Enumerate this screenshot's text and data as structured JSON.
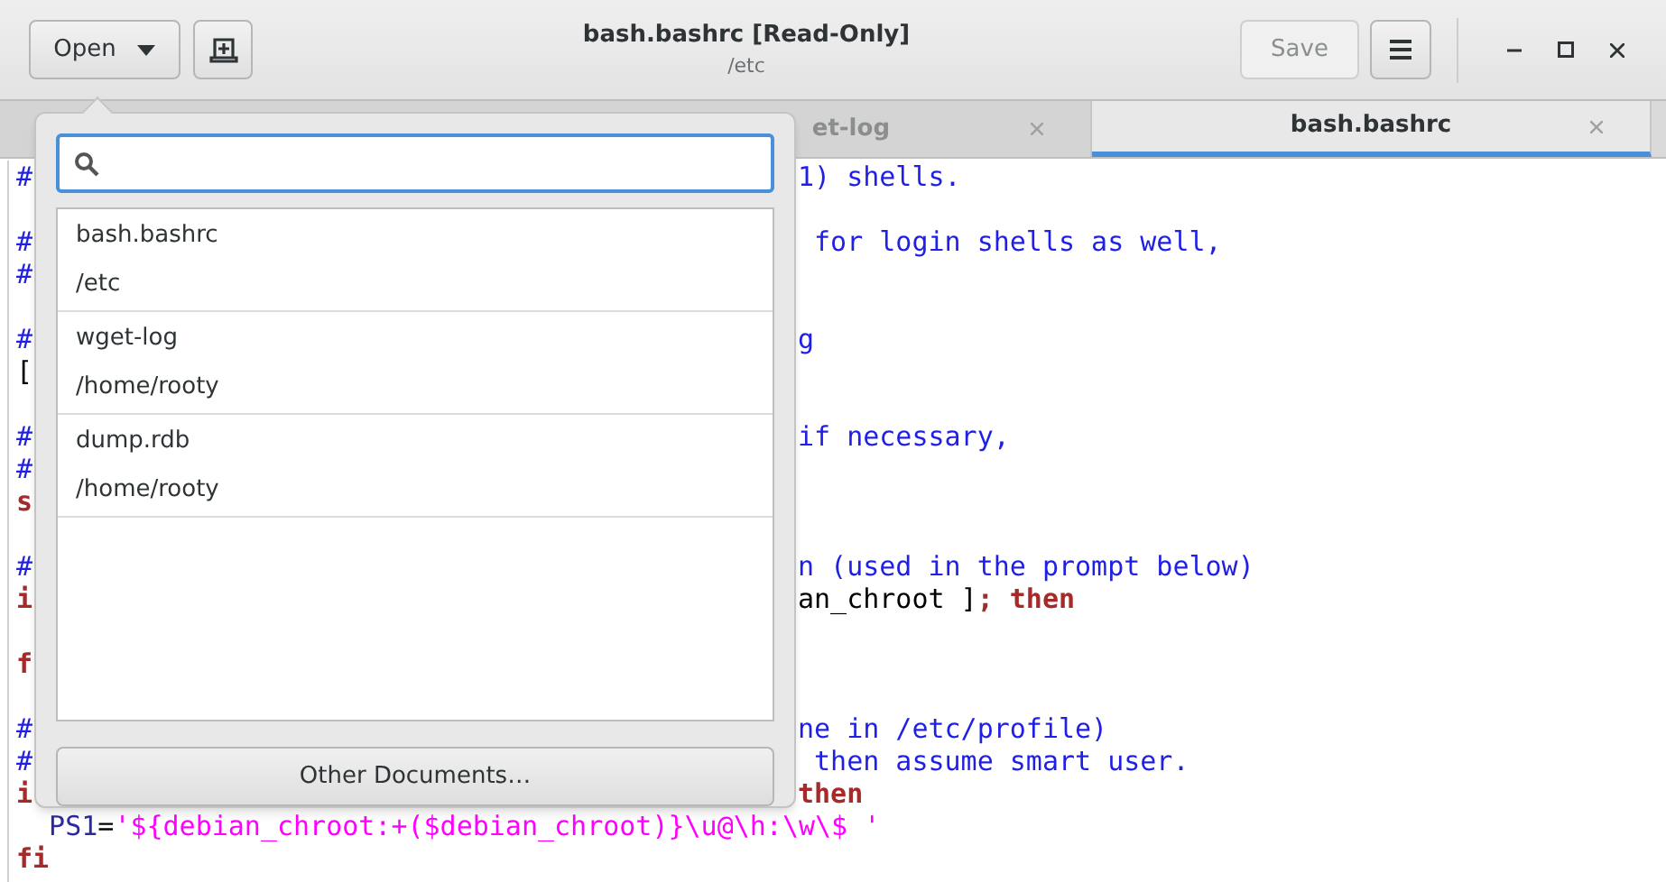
{
  "header": {
    "open_button": "Open",
    "title": "bash.bashrc [Read-Only]",
    "subtitle": "/etc",
    "save_button": {
      "label": "Save",
      "disabled": true
    }
  },
  "tabs": [
    {
      "label": "et-log",
      "selected": false
    },
    {
      "label": "bash.bashrc",
      "selected": true
    }
  ],
  "editor_lines": [
    {
      "kind": "code",
      "left": [
        {
          "text": "#",
          "kind": "comment"
        }
      ],
      "right": [
        {
          "text": "1) shells.",
          "kind": "comment"
        }
      ]
    },
    {
      "kind": "blank"
    },
    {
      "kind": "code",
      "left": [
        {
          "text": "#",
          "kind": "comment"
        }
      ],
      "right": [
        {
          "text": " for login shells as well,",
          "kind": "comment"
        }
      ]
    },
    {
      "kind": "code",
      "left": [
        {
          "text": "#",
          "kind": "comment"
        }
      ]
    },
    {
      "kind": "blank"
    },
    {
      "kind": "code",
      "left": [
        {
          "text": "#",
          "kind": "comment"
        }
      ],
      "right": [
        {
          "text": "g",
          "kind": "comment"
        }
      ]
    },
    {
      "kind": "code",
      "left": [
        {
          "text": "[",
          "kind": "plain"
        }
      ]
    },
    {
      "kind": "blank"
    },
    {
      "kind": "code",
      "left": [
        {
          "text": "#",
          "kind": "comment"
        }
      ],
      "right": [
        {
          "text": "if necessary,",
          "kind": "comment"
        }
      ]
    },
    {
      "kind": "code",
      "left": [
        {
          "text": "#",
          "kind": "comment"
        }
      ]
    },
    {
      "kind": "code",
      "left": [
        {
          "text": "s",
          "kind": "keyword"
        }
      ]
    },
    {
      "kind": "blank"
    },
    {
      "kind": "code",
      "left": [
        {
          "text": "#",
          "kind": "comment"
        }
      ],
      "right": [
        {
          "text": "n (used in the prompt below)",
          "kind": "comment"
        }
      ]
    },
    {
      "kind": "code",
      "left": [
        {
          "text": "i",
          "kind": "keyword"
        }
      ],
      "right": [
        {
          "text": "an_chroot ]",
          "kind": "plain"
        },
        {
          "text": "; then",
          "kind": "keyword"
        }
      ]
    },
    {
      "kind": "blank"
    },
    {
      "kind": "code",
      "left": [
        {
          "text": "f",
          "kind": "keyword"
        }
      ]
    },
    {
      "kind": "blank"
    },
    {
      "kind": "code",
      "left": [
        {
          "text": "#",
          "kind": "comment"
        }
      ],
      "right": [
        {
          "text": "ne in /etc/profile)",
          "kind": "comment"
        }
      ]
    },
    {
      "kind": "code",
      "left": [
        {
          "text": "#",
          "kind": "comment"
        }
      ],
      "right": [
        {
          "text": " then assume smart user.",
          "kind": "comment"
        }
      ]
    },
    {
      "kind": "code",
      "left": [
        {
          "text": "i",
          "kind": "keyword"
        }
      ],
      "right": [
        {
          "text": "then",
          "kind": "keyword"
        }
      ]
    },
    {
      "kind": "code",
      "left": [
        {
          "text": "  PS1",
          "kind": "variable"
        },
        {
          "text": "=",
          "kind": "plain"
        },
        {
          "text": "'${debian_chroot:+($debian_chroot)}\\u@\\h:\\w\\$ '",
          "kind": "string"
        }
      ]
    },
    {
      "kind": "code",
      "left": [
        {
          "text": "fi",
          "kind": "keyword"
        }
      ]
    }
  ],
  "popover": {
    "documents": [
      {
        "name": "bash.bashrc",
        "path": "/etc"
      },
      {
        "name": "wget-log",
        "path": "/home/rooty"
      },
      {
        "name": "dump.rdb",
        "path": "/home/rooty"
      }
    ],
    "other_button": "Other Documents…"
  }
}
